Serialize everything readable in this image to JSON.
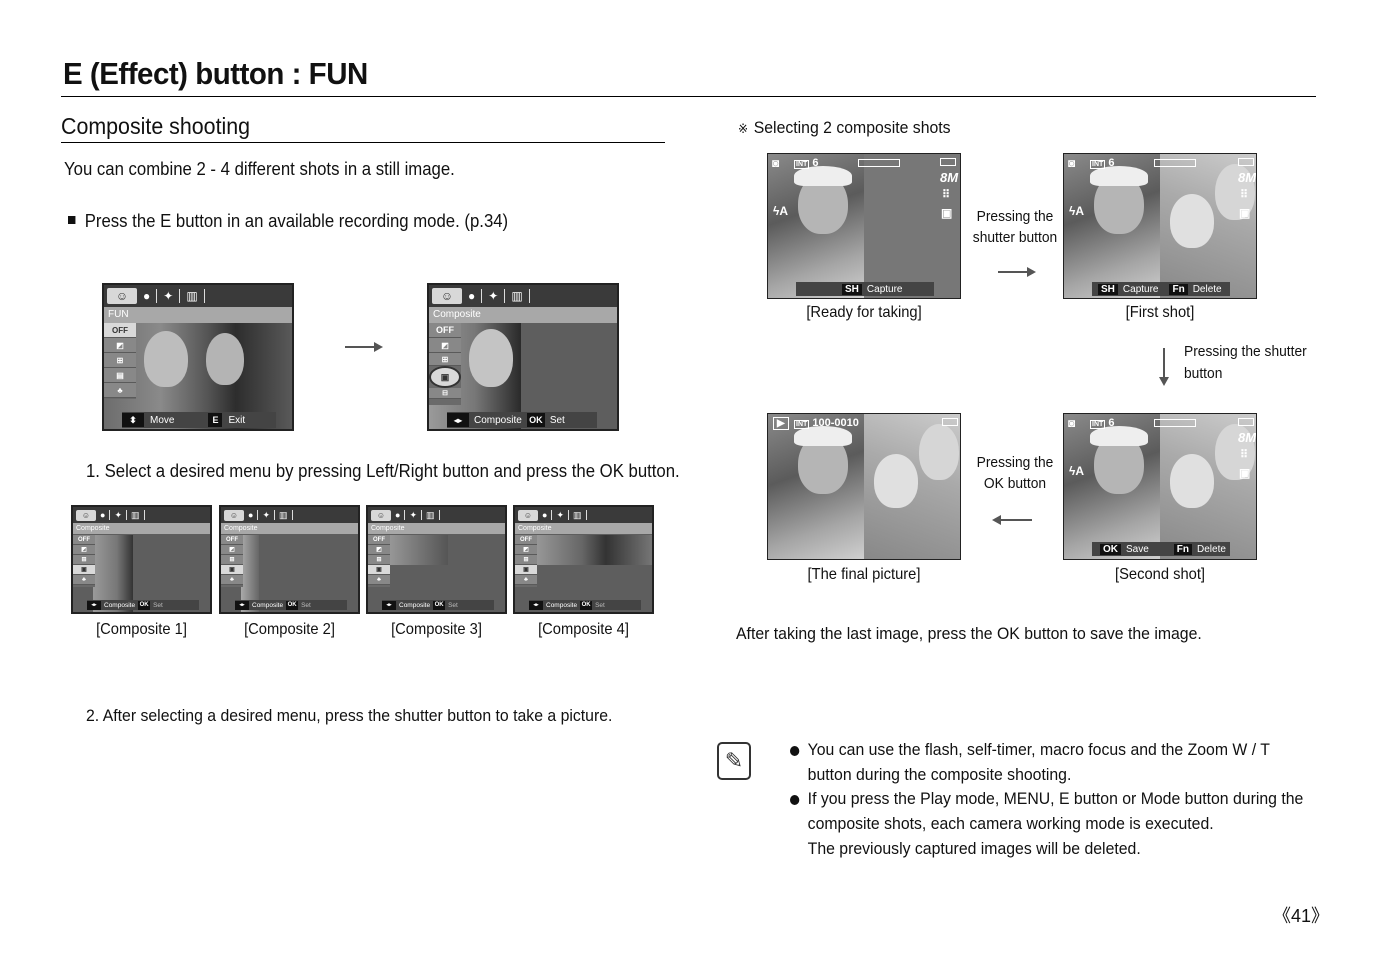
{
  "page": {
    "title": "E (Effect) button : FUN",
    "section_title": "Composite shooting",
    "intro": "You can combine 2 - 4 different shots in a still image.",
    "bullet": "Press the E button in an available recording mode. (p.34)",
    "step1": "1. Select a desired menu by pressing Left/Right button and press the OK button.",
    "step2": "2. After selecting a desired menu, press the shutter button to take a picture.",
    "page_number": "《41》"
  },
  "screen_fun": {
    "menu_title": "FUN",
    "items": [
      "OFF",
      "frame",
      "composite",
      "photo-frame",
      "sticker"
    ],
    "footer": {
      "key1": "⬍",
      "label1": "Move",
      "key2": "E",
      "label2": "Exit"
    }
  },
  "screen_composite": {
    "menu_title": "Composite",
    "items": [
      "OFF",
      "frame",
      "1",
      "2",
      "3"
    ],
    "footer": {
      "key1": "◂▸",
      "label1": "Composite",
      "key2": "OK",
      "label2": "Set"
    }
  },
  "composite_thumbs": [
    {
      "caption": "[Composite 1]",
      "menu_title": "Composite",
      "off": "OFF",
      "footer_key1": "◂▸",
      "footer_label1": "Composite",
      "footer_key2": "OK",
      "footer_label2": "Set"
    },
    {
      "caption": "[Composite 2]",
      "menu_title": "Composite",
      "off": "OFF",
      "footer_key1": "◂▸",
      "footer_label1": "Composite",
      "footer_key2": "OK",
      "footer_label2": "Set"
    },
    {
      "caption": "[Composite 3]",
      "menu_title": "Composite",
      "off": "OFF",
      "footer_key1": "◂▸",
      "footer_label1": "Composite",
      "footer_key2": "OK",
      "footer_label2": "Set"
    },
    {
      "caption": "[Composite 4]",
      "menu_title": "Composite",
      "off": "OFF",
      "footer_key1": "◂▸",
      "footer_label1": "Composite",
      "footer_key2": "OK",
      "footer_label2": "Set"
    }
  ],
  "right": {
    "heading_symbol": "※",
    "heading": "Selecting 2 composite shots",
    "screens": {
      "ready": {
        "caption": "[Ready for taking]",
        "count": "6",
        "size": "8M",
        "key1": "SH",
        "label1": "Capture"
      },
      "first": {
        "caption": "[First shot]",
        "count": "6",
        "size": "8M",
        "key1": "SH",
        "label1": "Capture",
        "key2": "Fn",
        "label2": "Delete"
      },
      "second": {
        "caption": "[Second shot]",
        "count": "6",
        "size": "8M",
        "key1": "OK",
        "label1": "Save",
        "key2": "Fn",
        "label2": "Delete"
      },
      "final": {
        "caption": "[The final picture]",
        "file": "100-0010"
      }
    },
    "annotations": {
      "shutter1_line1": "Pressing the",
      "shutter1_line2": "shutter button",
      "shutter2_line1": "Pressing the shutter",
      "shutter2_line2": "button",
      "ok_line1": "Pressing the",
      "ok_line2": "OK button"
    },
    "after_text": "After taking the last image, press the OK button to save the image."
  },
  "note": {
    "icon": "note-pencil-icon",
    "items": [
      [
        "You can use the flash, self-timer, macro focus and the Zoom W / T",
        "button during the composite shooting."
      ],
      [
        "If you press the Play mode, MENU, E button or Mode button during the",
        "composite shots, each camera working mode is executed.",
        "The previously captured images will be deleted."
      ]
    ]
  }
}
